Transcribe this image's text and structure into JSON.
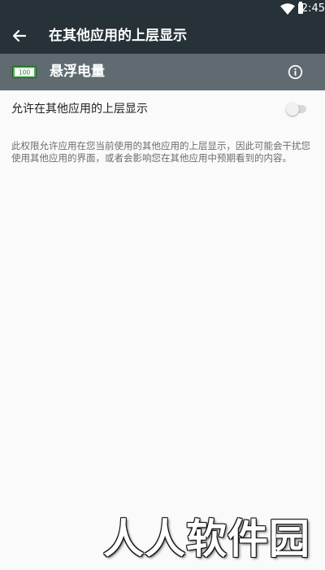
{
  "status_bar": {
    "time": "2:45",
    "wifi_icon": "wifi-icon",
    "battery_icon": "battery-icon"
  },
  "toolbar": {
    "back_icon": "arrow-back-icon",
    "title": "在其他应用的上层显示"
  },
  "app": {
    "icon_text": "100",
    "name": "悬浮电量",
    "info_icon": "info-icon"
  },
  "setting": {
    "label": "允许在其他应用的上层显示",
    "enabled": false
  },
  "description": "此权限允许应用在您当前使用的其他应用的上层显示，因此可能会干扰您使用其他应用的界面，或者会影响您在其他应用中预期看到的内容。",
  "watermark": "人人软件园",
  "colors": {
    "toolbar_bg": "#263238",
    "appbar_bg": "#5f6b70",
    "page_bg": "#fafafa",
    "battery_green": "#4caf50"
  }
}
